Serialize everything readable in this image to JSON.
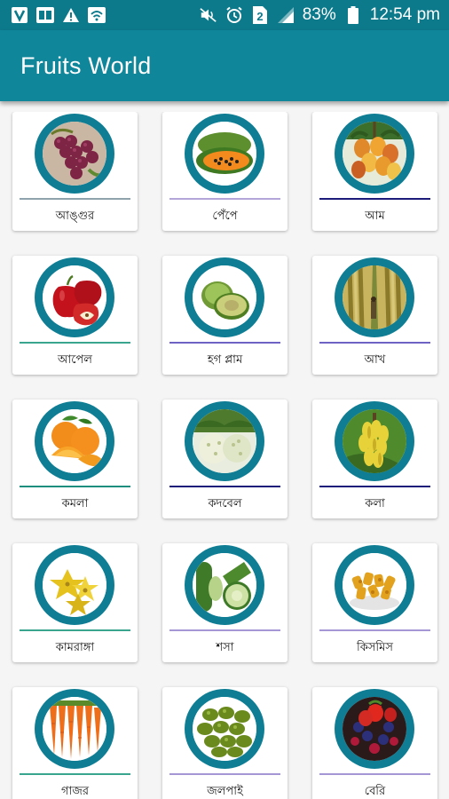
{
  "status_bar": {
    "left_icons": [
      "v-app-icon",
      "book-app-icon",
      "warning-icon",
      "wifi-box-icon"
    ],
    "right_icons": [
      "mute-icon",
      "alarm-icon",
      "sim-2-icon",
      "signal-icon",
      "battery-icon"
    ],
    "battery": "83%",
    "time": "12:54 pm"
  },
  "app_bar": {
    "title": "Fruits World"
  },
  "colors": {
    "app_bar": "#0f869a",
    "status_bar": "#0d7a8c",
    "ring": "#0f7e94"
  },
  "fruits": [
    {
      "label": "আঙ্গুর",
      "divider_color": "#8fa3ad",
      "icon": "grapes-icon"
    },
    {
      "label": "পেঁপে",
      "divider_color": "#b4a6d8",
      "icon": "papaya-icon"
    },
    {
      "label": "আম",
      "divider_color": "#1e1c7a",
      "icon": "mango-icon"
    },
    {
      "label": "আপেল",
      "divider_color": "#3aa58e",
      "icon": "apple-icon"
    },
    {
      "label": "হগ প্লাম",
      "divider_color": "#6e63c4",
      "icon": "hog-plum-icon"
    },
    {
      "label": "আখ",
      "divider_color": "#6e63c4",
      "icon": "sugarcane-icon"
    },
    {
      "label": "কমলা",
      "divider_color": "#1e8e7e",
      "icon": "orange-icon"
    },
    {
      "label": "কদবেল",
      "divider_color": "#1e1c7a",
      "icon": "wood-apple-icon"
    },
    {
      "label": "কলা",
      "divider_color": "#1e1c7a",
      "icon": "banana-icon"
    },
    {
      "label": "কামরাঙ্গা",
      "divider_color": "#3aa58e",
      "icon": "star-fruit-icon"
    },
    {
      "label": "শসা",
      "divider_color": "#a596d6",
      "icon": "cucumber-icon"
    },
    {
      "label": "কিসমিস",
      "divider_color": "#a596d6",
      "icon": "raisin-icon"
    },
    {
      "label": "গাজর",
      "divider_color": "#3aa58e",
      "icon": "carrot-icon"
    },
    {
      "label": "জলপাই",
      "divider_color": "#a596d6",
      "icon": "olive-icon"
    },
    {
      "label": "বেরি",
      "divider_color": "#a596d6",
      "icon": "berry-icon"
    }
  ]
}
